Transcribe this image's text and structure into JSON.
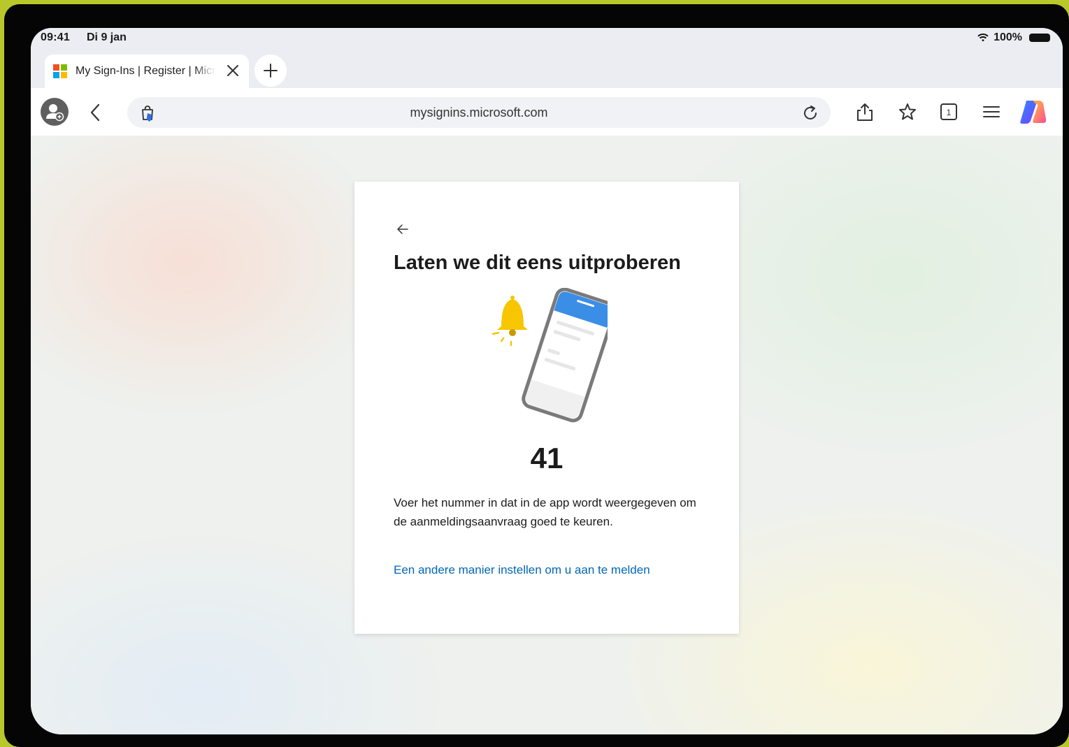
{
  "status_bar": {
    "time": "09:41",
    "date": "Di 9 jan",
    "battery": "100%"
  },
  "tabs": [
    {
      "title": "My Sign-Ins | Register | Microsoft"
    }
  ],
  "toolbar": {
    "url": "mysignins.microsoft.com",
    "tab_count": "1"
  },
  "card": {
    "title": "Laten we dit eens uitproberen",
    "number": "41",
    "instructions": "Voer het nummer in dat in de app wordt weergegeven om de aanmeldingsaanvraag goed te keuren.",
    "alt_link": "Een andere manier instellen om u aan te melden"
  },
  "colors": {
    "link": "#0067b8",
    "bell": "#f7c600",
    "phone_header": "#3a8ee6"
  },
  "icons": [
    "profile-icon",
    "back-icon",
    "shield-icon",
    "reload-icon",
    "share-icon",
    "star-icon",
    "tabs-icon",
    "menu-icon",
    "copilot-icon",
    "bell-icon",
    "phone-icon"
  ]
}
